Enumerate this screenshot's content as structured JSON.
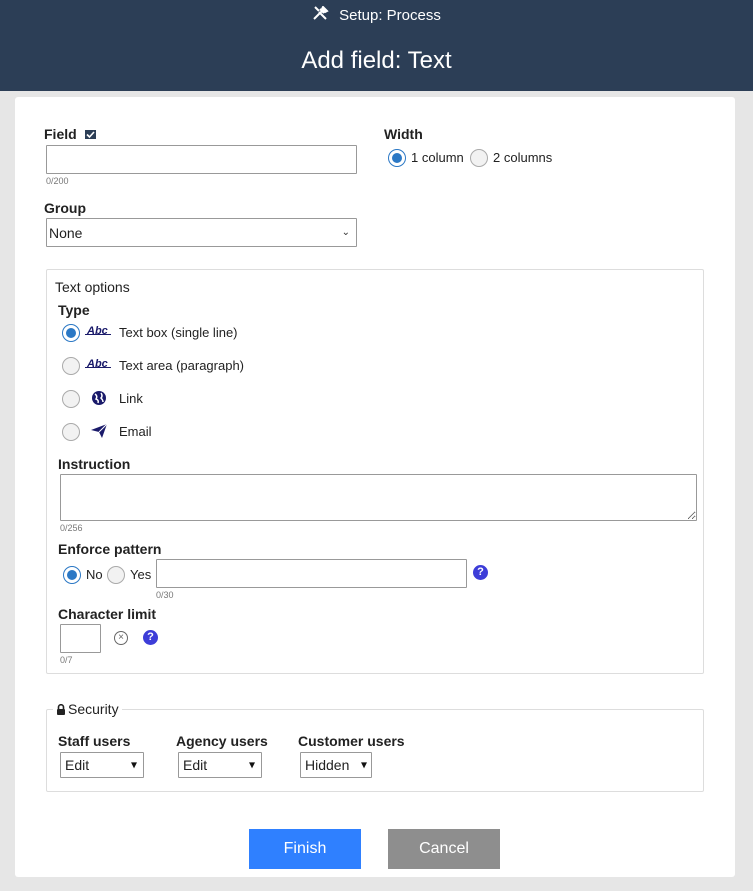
{
  "header": {
    "crumb": "Setup: Process",
    "title": "Add field: Text"
  },
  "field": {
    "label": "Field",
    "value": "",
    "count": "0/200"
  },
  "width": {
    "label": "Width",
    "options": [
      "1 column",
      "2 columns"
    ],
    "selected": "1 column"
  },
  "group": {
    "label": "Group",
    "selected": "None"
  },
  "text_options": {
    "title": "Text options",
    "type_label": "Type",
    "types": [
      {
        "label": "Text box (single line)",
        "icon": "abc-icon",
        "selected": true
      },
      {
        "label": "Text area (paragraph)",
        "icon": "abc-icon",
        "selected": false
      },
      {
        "label": "Link",
        "icon": "globe-icon",
        "selected": false
      },
      {
        "label": "Email",
        "icon": "paper-plane-icon",
        "selected": false
      }
    ],
    "abc_glyph": "Abc",
    "instruction": {
      "label": "Instruction",
      "value": "",
      "count": "0/256"
    },
    "pattern": {
      "label": "Enforce pattern",
      "no": "No",
      "yes": "Yes",
      "selected": "No",
      "value": "",
      "count": "0/30"
    },
    "char_limit": {
      "label": "Character limit",
      "value": "",
      "count": "0/7"
    }
  },
  "security": {
    "title": "Security",
    "staff": {
      "label": "Staff users",
      "selected": "Edit"
    },
    "agency": {
      "label": "Agency users",
      "selected": "Edit"
    },
    "customer": {
      "label": "Customer users",
      "selected": "Hidden"
    }
  },
  "buttons": {
    "finish": "Finish",
    "cancel": "Cancel"
  },
  "glyphs": {
    "help": "?",
    "clear": "×"
  },
  "colors": {
    "header_bg": "#2c3e56",
    "primary": "#2f80ff",
    "secondary": "#8e8e8e",
    "radio_on": "#2b78c5",
    "help": "#3d3dd8"
  }
}
